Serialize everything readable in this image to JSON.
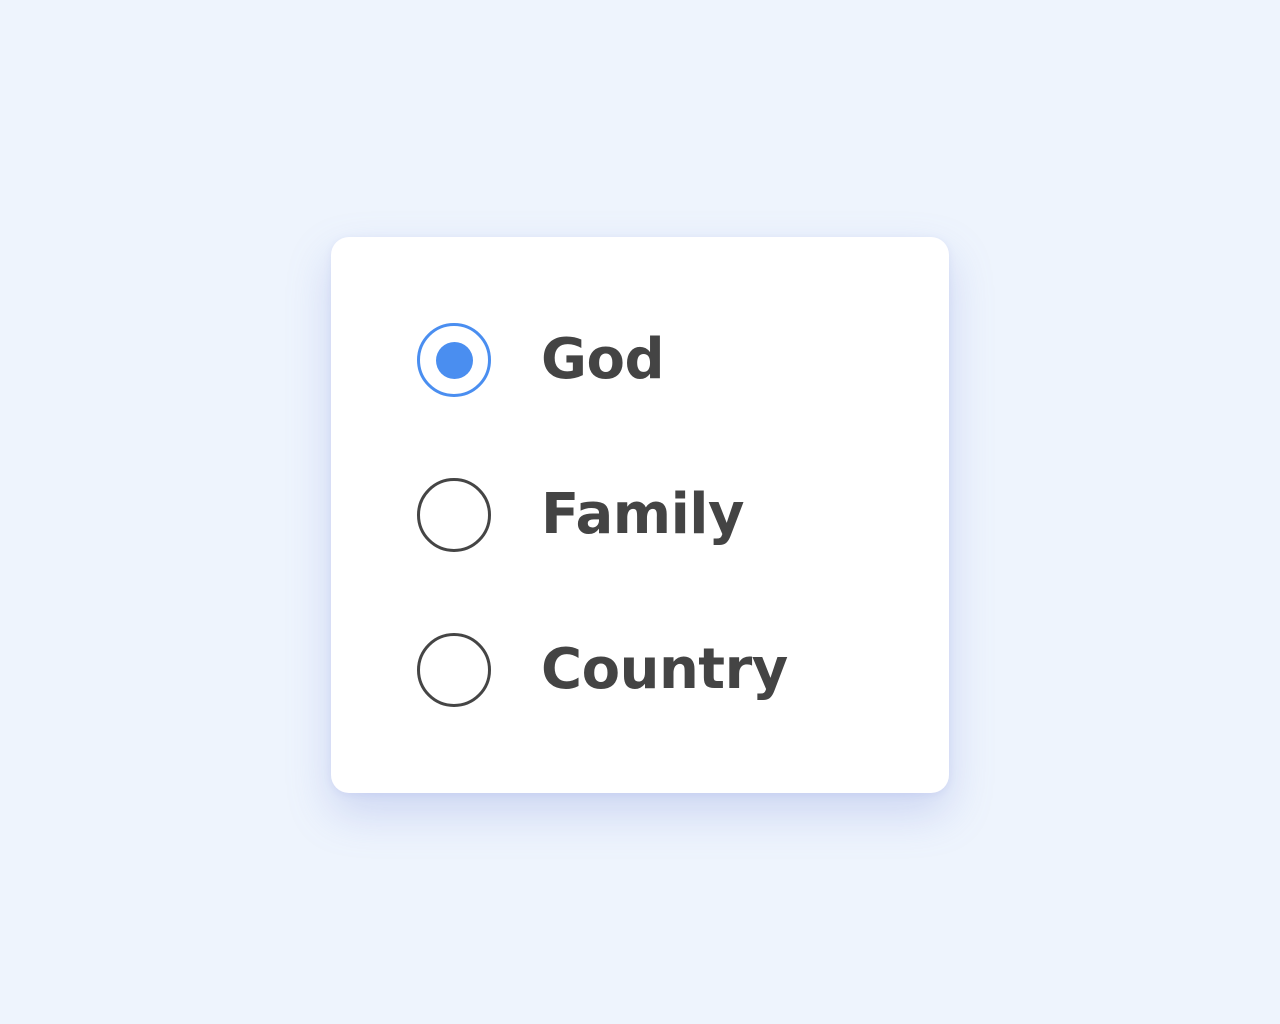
{
  "radio_group": {
    "options": [
      {
        "label": "God",
        "checked": true
      },
      {
        "label": "Family",
        "checked": false
      },
      {
        "label": "Country",
        "checked": false
      }
    ],
    "selected": "God"
  },
  "colors": {
    "background": "#eef4fd",
    "card": "#ffffff",
    "accent": "#4a8ef0",
    "text": "#444444",
    "radio_border": "#454545"
  }
}
